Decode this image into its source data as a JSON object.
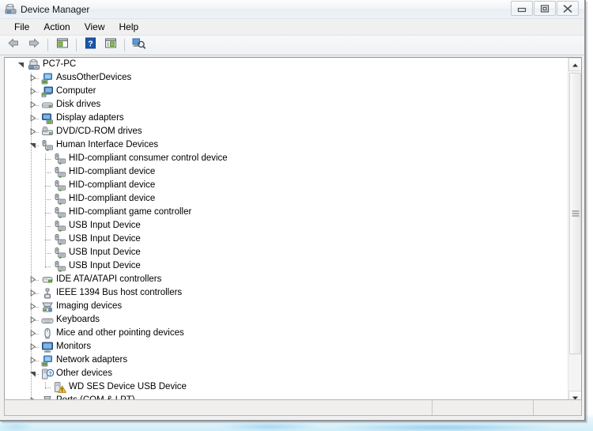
{
  "window": {
    "title": "Device Manager",
    "icon": "device-manager-icon",
    "controls": {
      "minimize": "Minimize",
      "maximize": "Restore Down",
      "close": "Close"
    }
  },
  "menubar": {
    "items": [
      {
        "label": "File"
      },
      {
        "label": "Action"
      },
      {
        "label": "View"
      },
      {
        "label": "Help"
      }
    ]
  },
  "toolbar": {
    "buttons": [
      {
        "name": "back-button",
        "icon": "back-arrow-icon",
        "tooltip": "Back"
      },
      {
        "name": "forward-button",
        "icon": "forward-arrow-icon",
        "tooltip": "Forward"
      },
      {
        "name": "properties-button",
        "icon": "properties-window-icon",
        "tooltip": "Properties"
      },
      {
        "name": "help-button",
        "icon": "help-question-icon",
        "tooltip": "Help"
      },
      {
        "name": "show-hidden-button",
        "icon": "window-list-icon",
        "tooltip": "Show hidden devices"
      },
      {
        "name": "scan-hardware-button",
        "icon": "scan-hardware-icon",
        "tooltip": "Scan for hardware changes"
      }
    ]
  },
  "tree": {
    "nodes": [
      {
        "label": "PC7-PC",
        "level": 0,
        "state": "expanded",
        "icon": "computer-root-icon"
      },
      {
        "label": "AsusOtherDevices",
        "level": 1,
        "state": "collapsed",
        "icon": "other-devices-category-icon"
      },
      {
        "label": "Computer",
        "level": 1,
        "state": "collapsed",
        "icon": "computer-icon"
      },
      {
        "label": "Disk drives",
        "level": 1,
        "state": "collapsed",
        "icon": "disk-drive-icon"
      },
      {
        "label": "Display adapters",
        "level": 1,
        "state": "collapsed",
        "icon": "display-adapter-icon"
      },
      {
        "label": "DVD/CD-ROM drives",
        "level": 1,
        "state": "collapsed",
        "icon": "dvd-drive-icon"
      },
      {
        "label": "Human Interface Devices",
        "level": 1,
        "state": "expanded",
        "icon": "hid-icon"
      },
      {
        "label": "HID-compliant consumer control device",
        "level": 2,
        "state": "leaf",
        "icon": "hid-device-icon"
      },
      {
        "label": "HID-compliant device",
        "level": 2,
        "state": "leaf",
        "icon": "hid-device-icon"
      },
      {
        "label": "HID-compliant device",
        "level": 2,
        "state": "leaf",
        "icon": "hid-device-icon"
      },
      {
        "label": "HID-compliant device",
        "level": 2,
        "state": "leaf",
        "icon": "hid-device-icon"
      },
      {
        "label": "HID-compliant game controller",
        "level": 2,
        "state": "leaf",
        "icon": "hid-device-icon"
      },
      {
        "label": "USB Input Device",
        "level": 2,
        "state": "leaf",
        "icon": "hid-device-icon"
      },
      {
        "label": "USB Input Device",
        "level": 2,
        "state": "leaf",
        "icon": "hid-device-icon"
      },
      {
        "label": "USB Input Device",
        "level": 2,
        "state": "leaf",
        "icon": "hid-device-icon"
      },
      {
        "label": "USB Input Device",
        "level": 2,
        "state": "leaf",
        "icon": "hid-device-icon"
      },
      {
        "label": "IDE ATA/ATAPI controllers",
        "level": 1,
        "state": "collapsed",
        "icon": "ide-controller-icon"
      },
      {
        "label": "IEEE 1394 Bus host controllers",
        "level": 1,
        "state": "collapsed",
        "icon": "ieee1394-icon"
      },
      {
        "label": "Imaging devices",
        "level": 1,
        "state": "collapsed",
        "icon": "imaging-device-icon"
      },
      {
        "label": "Keyboards",
        "level": 1,
        "state": "collapsed",
        "icon": "keyboard-icon"
      },
      {
        "label": "Mice and other pointing devices",
        "level": 1,
        "state": "collapsed",
        "icon": "mouse-icon"
      },
      {
        "label": "Monitors",
        "level": 1,
        "state": "collapsed",
        "icon": "monitor-icon"
      },
      {
        "label": "Network adapters",
        "level": 1,
        "state": "collapsed",
        "icon": "network-adapter-icon"
      },
      {
        "label": "Other devices",
        "level": 1,
        "state": "expanded",
        "icon": "unknown-device-icon"
      },
      {
        "label": "WD SES Device USB Device",
        "level": 2,
        "state": "leaf",
        "icon": "unknown-device-warning-icon"
      },
      {
        "label": "Ports (COM & LPT)",
        "level": 1,
        "state": "collapsed",
        "icon": "port-icon"
      }
    ]
  },
  "scrollbar": {
    "up_label": "Scroll up",
    "down_label": "Scroll down",
    "thumb_label": "Vertical scroll thumb"
  },
  "statusbar": {
    "main": "",
    "mid": "",
    "end": ""
  },
  "colors": {
    "window_bg": "#f0f0f0",
    "client_bg": "#ffffff",
    "text": "#000000",
    "accent_blue": "#2f6fae",
    "warning_yellow": "#ffc83d",
    "tree_line": "#9b9b9b"
  }
}
